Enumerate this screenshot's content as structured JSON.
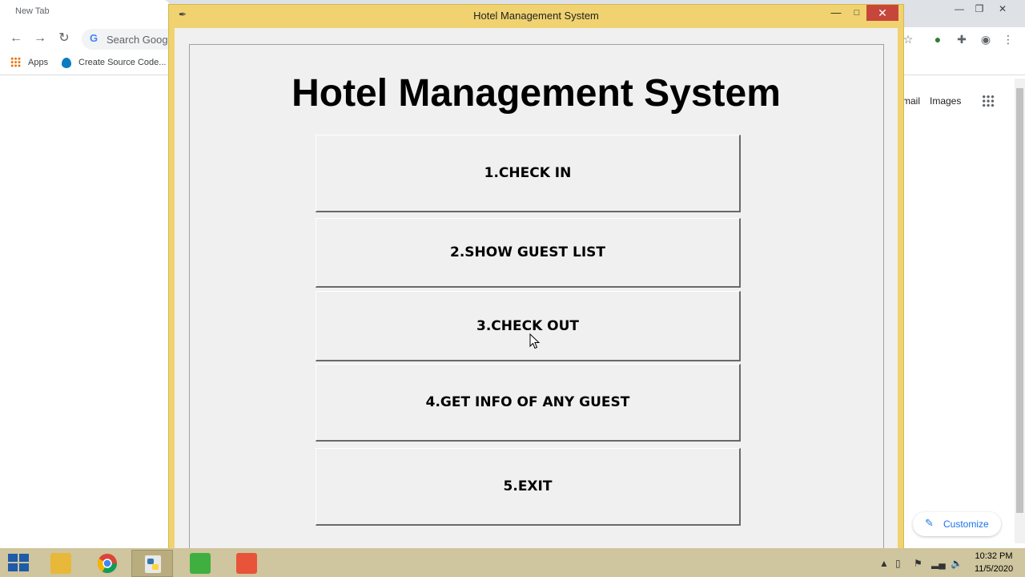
{
  "browser": {
    "tab_title": "New Tab",
    "omnibox_text": "Search Googl",
    "bookmarks": {
      "apps_label": "Apps",
      "create_label": "Create Source Code..."
    },
    "ntp_links": {
      "gmail": "mail",
      "images": "Images"
    },
    "customize_label": "Customize",
    "controls": {
      "minimize": "—",
      "restore": "❐",
      "close": "✕"
    }
  },
  "app_window": {
    "title": "Hotel Management System",
    "heading": "Hotel Management System",
    "buttons": [
      {
        "label": "1.CHECK IN"
      },
      {
        "label": "2.SHOW GUEST LIST"
      },
      {
        "label": "3.CHECK OUT"
      },
      {
        "label": "4.GET INFO OF ANY GUEST"
      },
      {
        "label": "5.EXIT"
      }
    ],
    "controls": {
      "minimize": "—",
      "maximize": "□",
      "close": "✕"
    }
  },
  "taskbar": {
    "items": [
      {
        "name": "file-explorer",
        "icon": "folder-icon",
        "color": "#e8b83a"
      },
      {
        "name": "chrome",
        "icon": "chrome-icon",
        "color": "#34a853"
      },
      {
        "name": "python",
        "icon": "python-icon",
        "color": "#3776ab"
      },
      {
        "name": "camtasia",
        "icon": "camtasia-icon",
        "color": "#3fb03f"
      },
      {
        "name": "camtasia-recorder",
        "icon": "camtasia-recorder-icon",
        "color": "#e8543a"
      }
    ],
    "clock_time": "10:32 PM",
    "clock_date": "11/5/2020"
  },
  "colors": {
    "tk_border": "#f0d370",
    "tk_close": "#c7463b",
    "taskbar": "#cfc59e",
    "chrome_accent": "#1a73e8"
  }
}
